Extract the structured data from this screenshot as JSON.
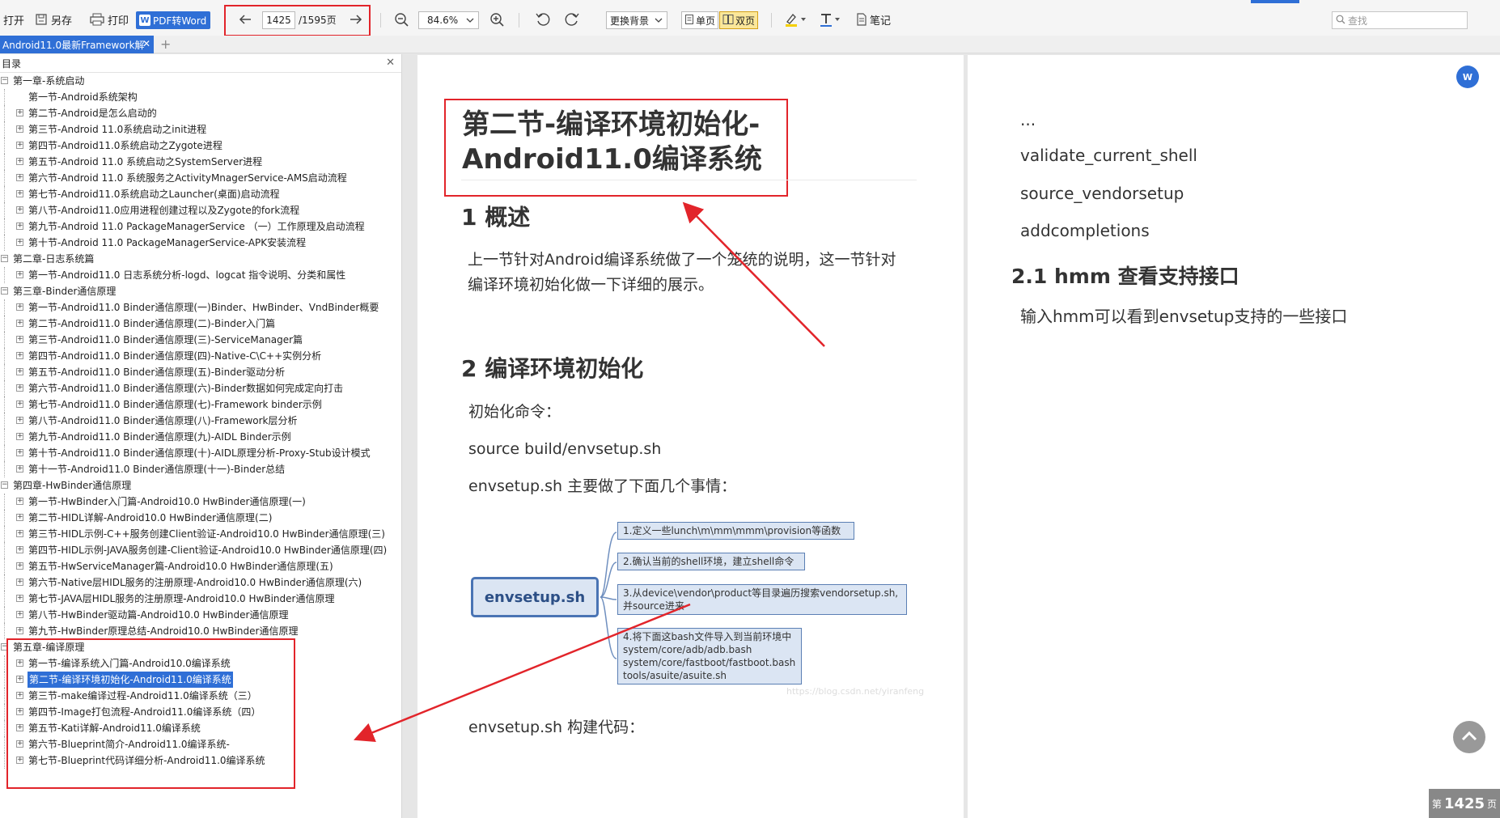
{
  "toolbar": {
    "open": "打开",
    "save_as": "另存",
    "print": "打印",
    "pdf_to_word": "PDF转Word",
    "current_page": "1425",
    "total_pages": "/1595页",
    "zoom": "84.6%",
    "background": "更换背景",
    "single_page": "单页",
    "double_page": "双页",
    "notes": "笔记",
    "search_placeholder": "查找"
  },
  "tab": {
    "title": "Android11.0最新Framework解"
  },
  "sidebar": {
    "title": "目录",
    "items": [
      {
        "level": 0,
        "label": "第一章-系统启动",
        "expander": "-"
      },
      {
        "level": 1,
        "label": "第一节-Android系统架构",
        "expander": ""
      },
      {
        "level": 1,
        "label": "第二节-Android是怎么启动的",
        "expander": "+"
      },
      {
        "level": 1,
        "label": "第三节-Android 11.0系统启动之init进程",
        "expander": "+"
      },
      {
        "level": 1,
        "label": "第四节-Android11.0系统启动之Zygote进程",
        "expander": "+"
      },
      {
        "level": 1,
        "label": "第五节-Android 11.0 系统启动之SystemServer进程",
        "expander": "+"
      },
      {
        "level": 1,
        "label": "第六节-Android 11.0 系统服务之ActivityMnagerService-AMS启动流程",
        "expander": "+"
      },
      {
        "level": 1,
        "label": "第七节-Android11.0系统启动之Launcher(桌面)启动流程",
        "expander": "+"
      },
      {
        "level": 1,
        "label": "第八节-Android11.0应用进程创建过程以及Zygote的fork流程",
        "expander": "+"
      },
      {
        "level": 1,
        "label": "第九节-Android 11.0 PackageManagerService （一）工作原理及启动流程",
        "expander": "+"
      },
      {
        "level": 1,
        "label": "第十节-Android 11.0 PackageManagerService-APK安装流程",
        "expander": "+"
      },
      {
        "level": 0,
        "label": "第二章-日志系统篇",
        "expander": "-"
      },
      {
        "level": 1,
        "label": "第一节-Android11.0 日志系统分析-logd、logcat 指令说明、分类和属性",
        "expander": "+"
      },
      {
        "level": 0,
        "label": "第三章-Binder通信原理",
        "expander": "-"
      },
      {
        "level": 1,
        "label": "第一节-Android11.0 Binder通信原理(一)Binder、HwBinder、VndBinder概要",
        "expander": "+"
      },
      {
        "level": 1,
        "label": "第二节-Android11.0 Binder通信原理(二)-Binder入门篇",
        "expander": "+"
      },
      {
        "level": 1,
        "label": "第三节-Android11.0 Binder通信原理(三)-ServiceManager篇",
        "expander": "+"
      },
      {
        "level": 1,
        "label": "第四节-Android11.0 Binder通信原理(四)-Native-C\\C++实例分析",
        "expander": "+"
      },
      {
        "level": 1,
        "label": "第五节-Android11.0 Binder通信原理(五)-Binder驱动分析",
        "expander": "+"
      },
      {
        "level": 1,
        "label": "第六节-Android11.0 Binder通信原理(六)-Binder数据如何完成定向打击",
        "expander": "+"
      },
      {
        "level": 1,
        "label": "第七节-Android11.0 Binder通信原理(七)-Framework binder示例",
        "expander": "+"
      },
      {
        "level": 1,
        "label": "第八节-Android11.0 Binder通信原理(八)-Framework层分析",
        "expander": "+"
      },
      {
        "level": 1,
        "label": "第九节-Android11.0 Binder通信原理(九)-AIDL Binder示例",
        "expander": "+"
      },
      {
        "level": 1,
        "label": "第十节-Android11.0 Binder通信原理(十)-AIDL原理分析-Proxy-Stub设计模式",
        "expander": "+"
      },
      {
        "level": 1,
        "label": "第十一节-Android11.0 Binder通信原理(十一)-Binder总结",
        "expander": "+"
      },
      {
        "level": 0,
        "label": "第四章-HwBinder通信原理",
        "expander": "-"
      },
      {
        "level": 1,
        "label": "第一节-HwBinder入门篇-Android10.0 HwBinder通信原理(一)",
        "expander": "+"
      },
      {
        "level": 1,
        "label": "第二节-HIDL详解-Android10.0 HwBinder通信原理(二)",
        "expander": "+"
      },
      {
        "level": 1,
        "label": "第三节-HIDL示例-C++服务创建Client验证-Android10.0 HwBinder通信原理(三)",
        "expander": "+"
      },
      {
        "level": 1,
        "label": "第四节-HIDL示例-JAVA服务创建-Client验证-Android10.0 HwBinder通信原理(四)",
        "expander": "+"
      },
      {
        "level": 1,
        "label": "第五节-HwServiceManager篇-Android10.0 HwBinder通信原理(五)",
        "expander": "+"
      },
      {
        "level": 1,
        "label": "第六节-Native层HIDL服务的注册原理-Android10.0 HwBinder通信原理(六)",
        "expander": "+"
      },
      {
        "level": 1,
        "label": "第七节-JAVA层HIDL服务的注册原理-Android10.0 HwBinder通信原理",
        "expander": "+"
      },
      {
        "level": 1,
        "label": "第八节-HwBinder驱动篇-Android10.0 HwBinder通信原理",
        "expander": "+"
      },
      {
        "level": 1,
        "label": "第九节-HwBinder原理总结-Android10.0 HwBinder通信原理",
        "expander": "+"
      },
      {
        "level": 0,
        "label": "第五章-编译原理",
        "expander": "-"
      },
      {
        "level": 1,
        "label": "第一节-编译系统入门篇-Android10.0编译系统",
        "expander": "+"
      },
      {
        "level": 1,
        "label": "第二节-编译环境初始化-Android11.0编译系统",
        "expander": "+",
        "selected": true
      },
      {
        "level": 1,
        "label": "第三节-make编译过程-Android11.0编译系统（三）",
        "expander": "+"
      },
      {
        "level": 1,
        "label": "第四节-Image打包流程-Android11.0编译系统（四）",
        "expander": "+"
      },
      {
        "level": 1,
        "label": "第五节-Kati详解-Android11.0编译系统",
        "expander": "+"
      },
      {
        "level": 1,
        "label": "第六节-Blueprint简介-Android11.0编译系统-",
        "expander": "+"
      },
      {
        "level": 1,
        "label": "第七节-Blueprint代码详细分析-Android11.0编译系统",
        "expander": "+"
      }
    ]
  },
  "page1": {
    "title_line1": "第二节-编译环境初始化-",
    "title_line2": "Android11.0编译系统",
    "h_overview": "1 概述",
    "overview_line1": "上一节针对Android编译系统做了一个笼统的说明，这一节针对",
    "overview_line2": "编译环境初始化做一下详细的展示。",
    "h_init": "2 编译环境初始化",
    "init_cmd_label": "初始化命令：",
    "init_cmd": "source build/envsetup.sh",
    "envsetup_does": "envsetup.sh 主要做了下面几个事情：",
    "mindmap": {
      "root": "envsetup.sh",
      "nodes": [
        "1.定义一些lunch\\m\\mm\\mmm\\provision等函数",
        "2.确认当前的shell环境，建立shell命令",
        "3.从device\\vendor\\product等目录遍历搜索vendorsetup.sh,",
        "并source进来",
        "4.将下面这bash文件导入到当前环境中",
        "system/core/adb/adb.bash",
        "system/core/fastboot/fastboot.bash",
        "tools/asuite/asuite.sh"
      ],
      "watermark": "https://blog.csdn.net/yiranfeng"
    },
    "build_code": "envsetup.sh 构建代码："
  },
  "page2": {
    "lines": [
      "...",
      "validate_current_shell",
      "source_vendorsetup",
      "addcompletions"
    ],
    "h_hmm": "2.1 hmm 查看支持接口",
    "hmm_desc": "输入hmm可以看到envsetup支持的一些接口"
  },
  "page_badge": {
    "prefix": "第",
    "number": "1425",
    "suffix": "页"
  },
  "colors": {
    "accent": "#2f6fd6",
    "annotation_red": "#e2242a",
    "highlight": "#fbe79a"
  }
}
